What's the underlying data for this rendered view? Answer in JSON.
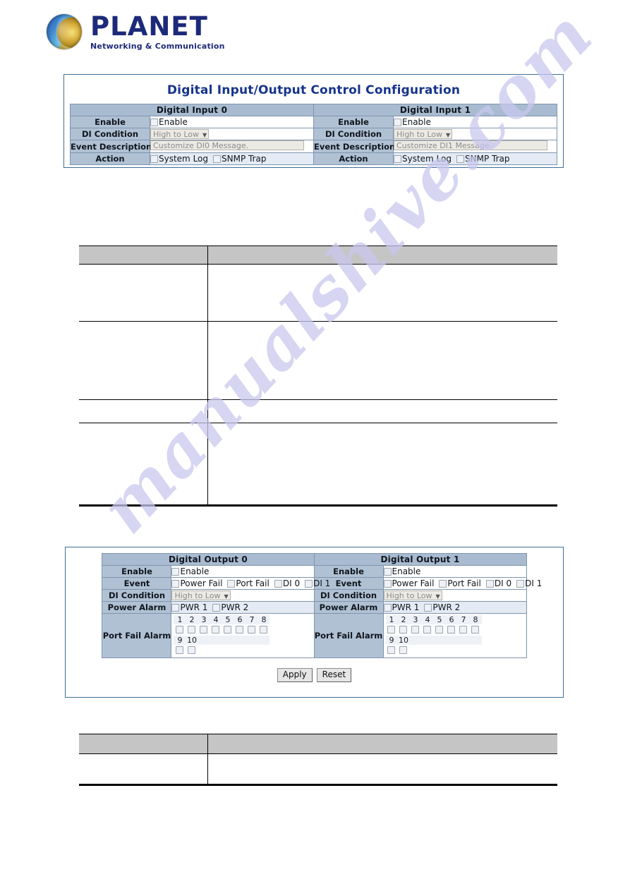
{
  "brand": {
    "name": "PLANET",
    "tagline": "Networking & Communication",
    "logo_icon": "globe-icon",
    "text_color": "#1d2a7a"
  },
  "watermark": {
    "text": "manualshive.com",
    "color": "#c9c7ee"
  },
  "digital_input_panel": {
    "title": "Digital Input/Output Control Configuration",
    "columns": [
      {
        "header": "Digital Input 0",
        "rows": [
          {
            "label": "Enable",
            "type": "checkbox",
            "checkbox_label": "Enable",
            "checked": false
          },
          {
            "label": "DI Condition",
            "type": "select",
            "value": "High to Low"
          },
          {
            "label": "Event Description",
            "type": "text",
            "placeholder": "Customize DI0 Message."
          },
          {
            "label": "Action",
            "type": "checkbox-group",
            "options": [
              "System Log",
              "SNMP Trap"
            ]
          }
        ]
      },
      {
        "header": "Digital Input 1",
        "rows": [
          {
            "label": "Enable",
            "type": "checkbox",
            "checkbox_label": "Enable",
            "checked": false
          },
          {
            "label": "DI Condition",
            "type": "select",
            "value": "High to Low"
          },
          {
            "label": "Event Description",
            "type": "text",
            "placeholder": "Customize DI1 Message."
          },
          {
            "label": "Action",
            "type": "checkbox-group",
            "options": [
              "System Log",
              "SNMP Trap"
            ]
          }
        ]
      }
    ]
  },
  "digital_output_panel": {
    "columns": [
      {
        "header": "Digital Output 0",
        "rows": [
          {
            "label": "Enable",
            "type": "checkbox",
            "checkbox_label": "Enable",
            "checked": false
          },
          {
            "label": "Event",
            "type": "checkbox-group",
            "options": [
              "Power Fail",
              "Port Fail",
              "DI 0",
              "DI 1"
            ]
          },
          {
            "label": "DI Condition",
            "type": "select",
            "value": "High to Low"
          },
          {
            "label": "Power Alarm",
            "type": "checkbox-group",
            "options": [
              "PWR 1",
              "PWR 2"
            ]
          },
          {
            "label": "Port Fail Alarm",
            "type": "port-grid",
            "rows": [
              [
                "1",
                "2",
                "3",
                "4",
                "5",
                "6",
                "7",
                "8"
              ],
              [
                "9",
                "10"
              ]
            ]
          }
        ]
      },
      {
        "header": "Digital Output 1",
        "rows": [
          {
            "label": "Enable",
            "type": "checkbox",
            "checkbox_label": "Enable",
            "checked": false
          },
          {
            "label": "Event",
            "type": "checkbox-group",
            "options": [
              "Power Fail",
              "Port Fail",
              "DI 0",
              "DI 1"
            ]
          },
          {
            "label": "DI Condition",
            "type": "select",
            "value": "High to Low"
          },
          {
            "label": "Power Alarm",
            "type": "checkbox-group",
            "options": [
              "PWR 1",
              "PWR 2"
            ]
          },
          {
            "label": "Port Fail Alarm",
            "type": "port-grid",
            "rows": [
              [
                "1",
                "2",
                "3",
                "4",
                "5",
                "6",
                "7",
                "8"
              ],
              [
                "9",
                "10"
              ]
            ]
          }
        ]
      }
    ],
    "buttons": {
      "apply": "Apply",
      "reset": "Reset"
    }
  },
  "doc_table_top": {
    "header": [
      "",
      ""
    ],
    "rows": [
      [
        "",
        ""
      ],
      [
        "",
        ""
      ],
      [
        "",
        ""
      ],
      [
        "",
        ""
      ]
    ]
  },
  "doc_table_bottom": {
    "header": [
      "",
      ""
    ],
    "rows": [
      [
        "",
        ""
      ]
    ]
  }
}
